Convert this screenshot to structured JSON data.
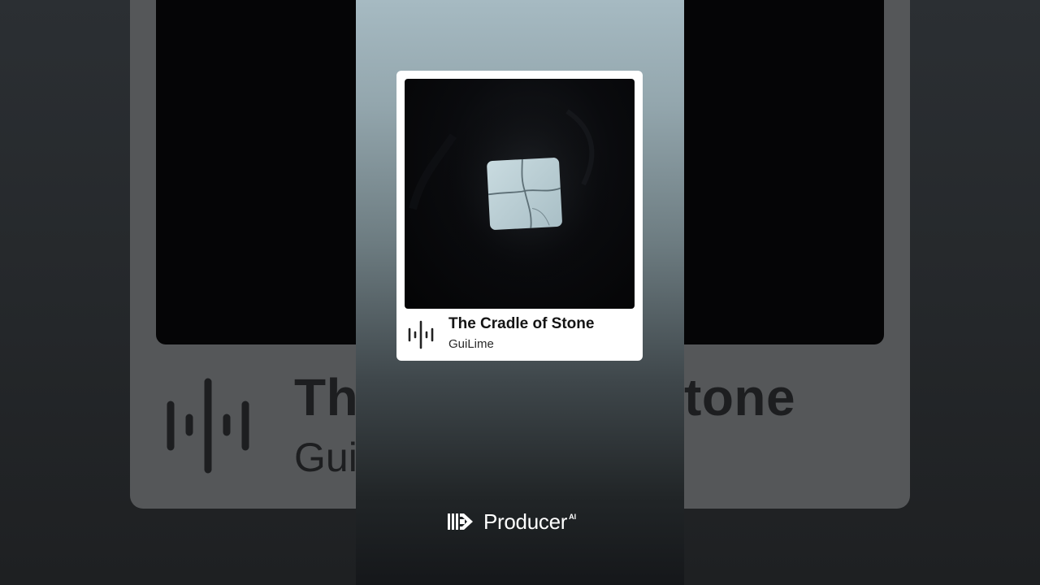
{
  "track": {
    "title": "The Cradle of Stone",
    "artist": "GuiLime",
    "cover_icon": "cracked-stone-tile",
    "waveform_icon": "waveform-icon"
  },
  "background": {
    "title_fragment_left": "Th",
    "title_fragment_right": "tone",
    "artist_fragment": "Gui"
  },
  "brand": {
    "name": "Producer",
    "suffix": "AI",
    "logo_icon": "producer-logo-icon"
  },
  "colors": {
    "card_bg": "#ffffff",
    "text_dark": "#141414",
    "brand_text": "#ffffff"
  }
}
